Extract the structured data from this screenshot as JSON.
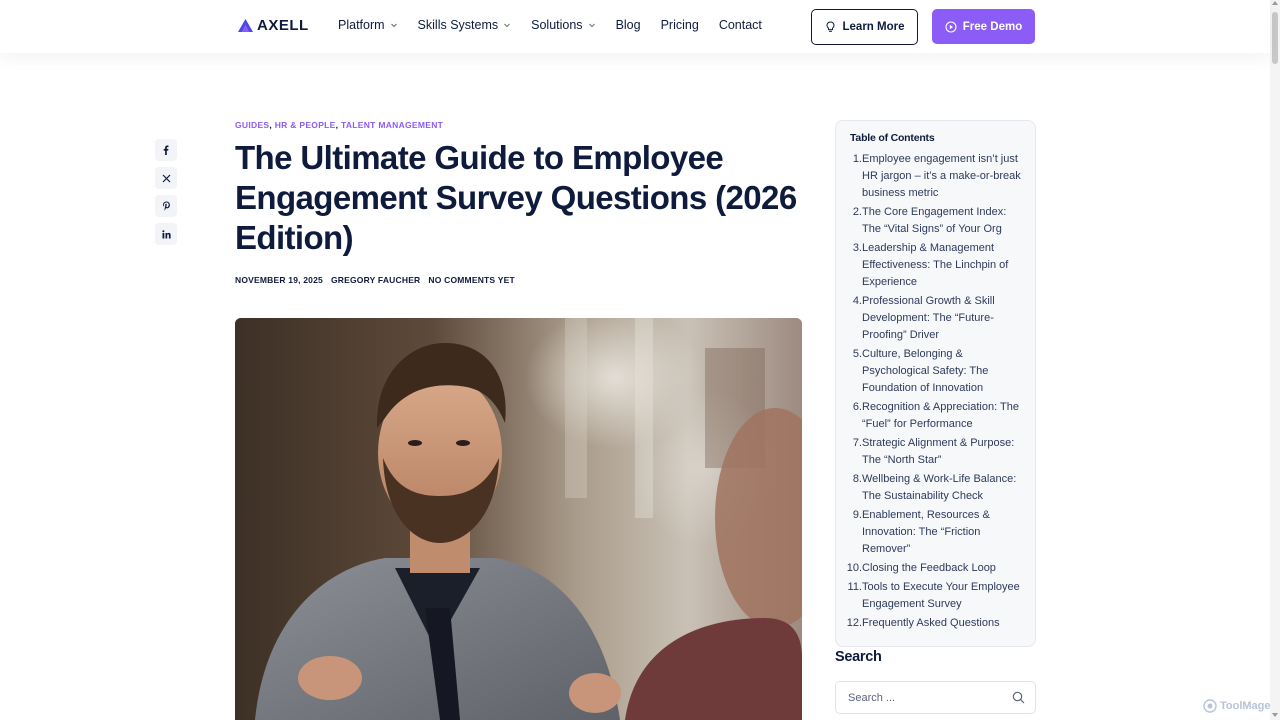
{
  "header": {
    "logo_text": "AXELL",
    "nav": [
      {
        "label": "Platform",
        "has_dropdown": true
      },
      {
        "label": "Skills Systems",
        "has_dropdown": true
      },
      {
        "label": "Solutions",
        "has_dropdown": true
      },
      {
        "label": "Blog",
        "has_dropdown": false
      },
      {
        "label": "Pricing",
        "has_dropdown": false
      },
      {
        "label": "Contact",
        "has_dropdown": false
      }
    ],
    "learn_more_label": "Learn More",
    "free_demo_label": "Free Demo"
  },
  "share": {
    "icons": [
      "facebook-icon",
      "x-icon",
      "pinterest-icon",
      "linkedin-icon"
    ]
  },
  "article": {
    "categories": [
      "GUIDES",
      "HR & PEOPLE",
      "TALENT MANAGEMENT"
    ],
    "title": "The Ultimate Guide to Employee Engagement Survey Questions (2026 Edition)",
    "date": "NOVEMBER 19, 2025",
    "author": "GREGORY FAUCHER",
    "comments": "NO COMMENTS YET"
  },
  "toc": {
    "title": "Table of Contents",
    "items": [
      {
        "num": "1.",
        "text": "Employee engagement isn’t just HR jargon – it’s a make-or-break business metric"
      },
      {
        "num": "2.",
        "text": "The Core Engagement Index: The “Vital Signs” of Your Org"
      },
      {
        "num": "3.",
        "text": "Leadership & Management Effectiveness: The Linchpin of Experience"
      },
      {
        "num": "4.",
        "text": "Professional Growth & Skill Development: The “Future-Proofing” Driver"
      },
      {
        "num": "5.",
        "text": "Culture, Belonging & Psychological Safety: The Foundation of Innovation"
      },
      {
        "num": "6.",
        "text": "Recognition & Appreciation: The “Fuel” for Performance"
      },
      {
        "num": "7.",
        "text": "Strategic Alignment & Purpose: The “North Star”"
      },
      {
        "num": "8.",
        "text": "Wellbeing & Work-Life Balance: The Sustainability Check"
      },
      {
        "num": "9.",
        "text": "Enablement, Resources & Innovation: The “Friction Remover”"
      },
      {
        "num": "10.",
        "text": "Closing the Feedback Loop"
      },
      {
        "num": "11.",
        "text": "Tools to Execute Your Employee Engagement Survey"
      },
      {
        "num": "12.",
        "text": "Frequently Asked Questions"
      }
    ]
  },
  "search": {
    "title": "Search",
    "placeholder": "Search ..."
  },
  "watermark": "ToolMage",
  "colors": {
    "accent": "#8b5cf6",
    "text_dark": "#0f1b3d",
    "toc_bg": "#f7f8fa"
  }
}
